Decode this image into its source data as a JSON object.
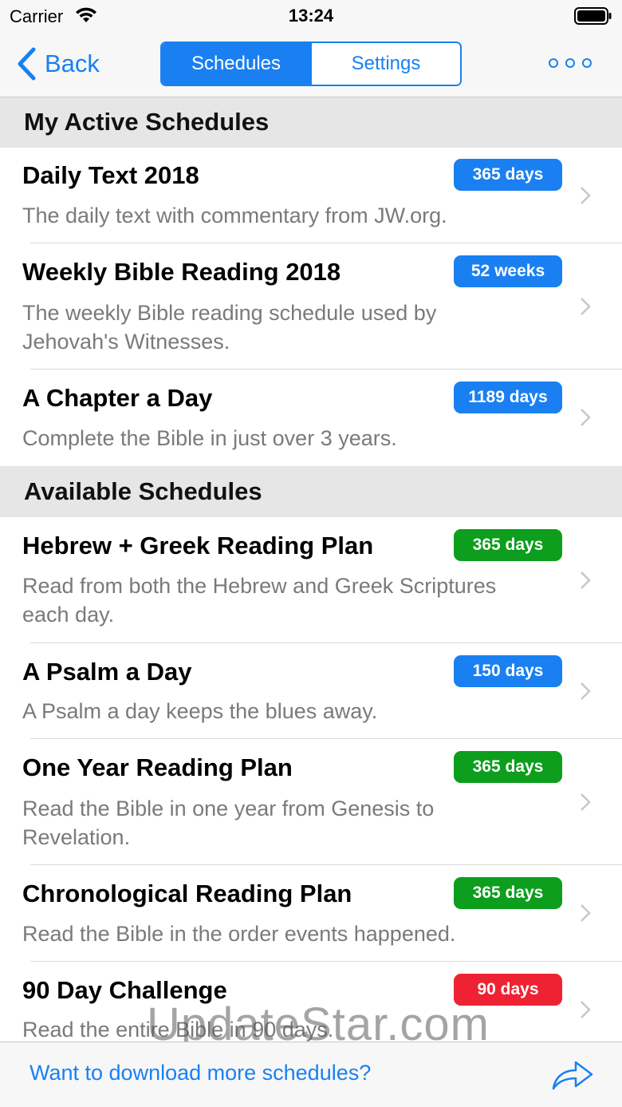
{
  "status_bar": {
    "carrier": "Carrier",
    "time": "13:24"
  },
  "nav": {
    "back_label": "Back",
    "segments": [
      {
        "label": "Schedules",
        "active": true
      },
      {
        "label": "Settings",
        "active": false
      }
    ]
  },
  "sections": [
    {
      "title": "My Active Schedules",
      "rows": [
        {
          "title": "Daily Text 2018",
          "description": "The daily text with commentary from JW.org.",
          "badge": "365 days",
          "badge_color": "#1a80f2"
        },
        {
          "title": "Weekly Bible Reading 2018",
          "description": "The weekly Bible reading schedule used by Jehovah's Witnesses.",
          "badge": "52 weeks",
          "badge_color": "#1a80f2"
        },
        {
          "title": "A Chapter a Day",
          "description": "Complete the Bible in just over 3 years.",
          "badge": "1189 days",
          "badge_color": "#1a80f2"
        }
      ]
    },
    {
      "title": "Available Schedules",
      "rows": [
        {
          "title": "Hebrew + Greek Reading Plan",
          "description": "Read from both the Hebrew and Greek Scriptures each day.",
          "badge": "365 days",
          "badge_color": "#0c9e1c"
        },
        {
          "title": "A Psalm a Day",
          "description": "A Psalm a day keeps the blues away.",
          "badge": "150 days",
          "badge_color": "#1a80f2"
        },
        {
          "title": "One Year Reading Plan",
          "description": "Read the Bible in one year from Genesis to Revelation.",
          "badge": "365 days",
          "badge_color": "#0c9e1c"
        },
        {
          "title": "Chronological Reading Plan",
          "description": "Read the Bible in the order events happened.",
          "badge": "365 days",
          "badge_color": "#0c9e1c"
        },
        {
          "title": "90 Day Challenge",
          "description": "Read the entire Bible in 90 days.",
          "badge": "90 days",
          "badge_color": "#ee2233"
        }
      ]
    }
  ],
  "toolbar": {
    "download_label": "Want to download more schedules?"
  },
  "watermark": "UpdateStar.com",
  "colors": {
    "accent": "#1a80f2",
    "green": "#0c9e1c",
    "red": "#ee2233"
  }
}
